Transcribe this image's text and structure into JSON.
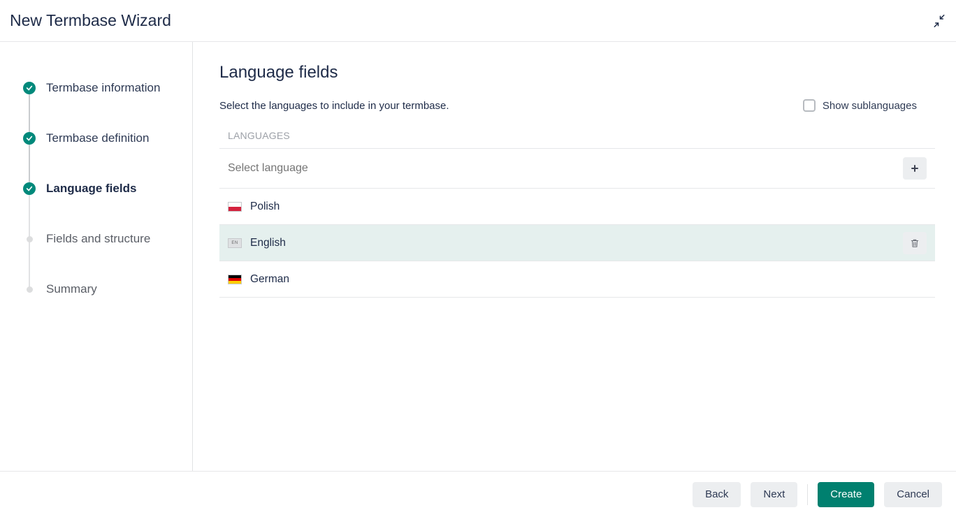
{
  "titlebar": {
    "title": "New Termbase Wizard"
  },
  "stepper": {
    "steps": [
      {
        "id": "termbase-info",
        "label": "Termbase information",
        "state": "done"
      },
      {
        "id": "termbase-def",
        "label": "Termbase definition",
        "state": "done"
      },
      {
        "id": "language-fields",
        "label": "Language fields",
        "state": "current"
      },
      {
        "id": "fields-structure",
        "label": "Fields and structure",
        "state": "pending"
      },
      {
        "id": "summary",
        "label": "Summary",
        "state": "pending"
      }
    ]
  },
  "page": {
    "heading": "Language fields",
    "description": "Select the languages to include in your termbase.",
    "showSublanguagesLabel": "Show sublanguages",
    "showSublanguagesChecked": false,
    "sectionLabel": "LANGUAGES",
    "selectPlaceholder": "Select language",
    "languages": [
      {
        "name": "Polish",
        "flag": "poland",
        "selected": false
      },
      {
        "name": "English",
        "flag": "en",
        "selected": true
      },
      {
        "name": "German",
        "flag": "germany",
        "selected": false
      }
    ]
  },
  "footer": {
    "back": "Back",
    "next": "Next",
    "create": "Create",
    "cancel": "Cancel"
  }
}
